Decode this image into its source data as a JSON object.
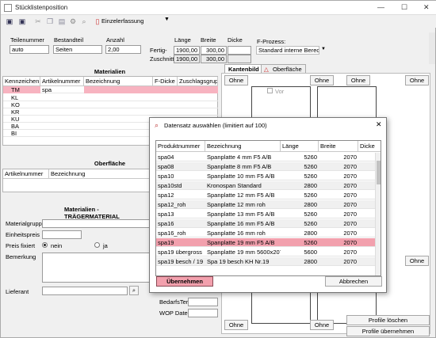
{
  "window": {
    "title": "Stücklistenposition"
  },
  "toolbar": {
    "view_label": "Einzelerfassung"
  },
  "header": {
    "teilenummer_label": "Teilenummer",
    "teilenummer_value": "auto",
    "bestandteil_label": "Bestandteil",
    "bestandteil_value": "Seiten",
    "anzahl_label": "Anzahl",
    "anzahl_value": "2,00",
    "laenge_label": "Länge",
    "breite_label": "Breite",
    "dicke_label": "Dicke",
    "fertig_label": "Fertig-",
    "zuschnitt_label": "Zuschnitt-",
    "fertig_laenge": "1900,00",
    "fertig_breite": "300,00",
    "zuschnitt_laenge": "1900,00",
    "zuschnitt_breite": "300,00",
    "fprozess_label": "F-Prozess:",
    "fprozess_value": "Standard interne Berechnur"
  },
  "materialien": {
    "title": "Materialien",
    "columns": [
      "Kennzeichen",
      "Artikelnummer",
      "Bezeichnung",
      "F-Dicke",
      "Zuschlagsgrupp"
    ],
    "rows": [
      {
        "kz": "TM",
        "art": "spa"
      },
      {
        "kz": "KL",
        "art": ""
      },
      {
        "kz": "KO",
        "art": ""
      },
      {
        "kz": "KR",
        "art": ""
      },
      {
        "kz": "KU",
        "art": ""
      },
      {
        "kz": "BA",
        "art": ""
      },
      {
        "kz": "BI",
        "art": ""
      }
    ]
  },
  "oberflaeche": {
    "title": "Oberfläche",
    "columns": [
      "Artikelnummer",
      "Bezeichnung"
    ]
  },
  "traeger": {
    "title": "Materialien - TRÄGERMATERIAL",
    "materialgruppe_label": "Materialgruppe",
    "einheitspreis_label": "Einheitspreis",
    "preis_fixiert_label": "Preis fixiert",
    "nein_label": "nein",
    "ja_label": "ja",
    "bemerkung_label": "Bemerkung",
    "lieferant_label": "Lieferant",
    "bedarfstermin_label": "BedarfsTermin",
    "wop_label": "WOP Datei"
  },
  "tabs": {
    "kantenbild": "Kantenbild",
    "oberflaeche": "Oberfläche"
  },
  "right": {
    "vor_label": "Vor",
    "ohne": "Ohne",
    "profile_loeschen": "Profile löschen",
    "profile_uebernehmen": "Profile übernehmen"
  },
  "dialog": {
    "title": "Datensatz auswählen (limitiert auf 100)",
    "columns": [
      "Produktnummer",
      "Bezeichnung",
      "Länge",
      "Breite",
      "Dicke"
    ],
    "rows": [
      {
        "nr": "spa04",
        "bez": "Spanplatte 4 mm F5 A/B",
        "l": "5260",
        "b": "2070"
      },
      {
        "nr": "spa08",
        "bez": "Spanplatte 8 mm F5 A/B",
        "l": "5260",
        "b": "2070"
      },
      {
        "nr": "spa10",
        "bez": "Spanplatte 10 mm F5 A/B",
        "l": "5260",
        "b": "2070"
      },
      {
        "nr": "spa10std",
        "bez": "Kronospan Standard",
        "l": "2800",
        "b": "2070"
      },
      {
        "nr": "spa12",
        "bez": "Spanplatte 12 mm F5 A/B",
        "l": "5260",
        "b": "2070"
      },
      {
        "nr": "spa12_roh",
        "bez": "Spanplatte 12 mm roh",
        "l": "2800",
        "b": "2070"
      },
      {
        "nr": "spa13",
        "bez": "Spanplatte 13 mm F5 A/B",
        "l": "5260",
        "b": "2070"
      },
      {
        "nr": "spa16",
        "bez": "Spanplatte 16 mm F5 A/B",
        "l": "5260",
        "b": "2070"
      },
      {
        "nr": "spa16_roh",
        "bez": "Spanplatte 16 mm roh",
        "l": "2800",
        "b": "2070"
      },
      {
        "nr": "spa19",
        "bez": "Spanplatte 19 mm F5 A/B",
        "l": "5260",
        "b": "2070"
      },
      {
        "nr": "spa19 übergross",
        "bez": "Spanplatte 19 mm 5600x2070",
        "l": "5600",
        "b": "2070"
      },
      {
        "nr": "spa19 besch / 19",
        "bez": "Spa 19 besch KH Nr.19",
        "l": "2800",
        "b": "2070"
      }
    ],
    "ok_label": "Übernehmen",
    "cancel_label": "Abbrechen"
  },
  "colors": {
    "selection": "#f7b3c0",
    "highlight_row": "#f2a0ad"
  }
}
